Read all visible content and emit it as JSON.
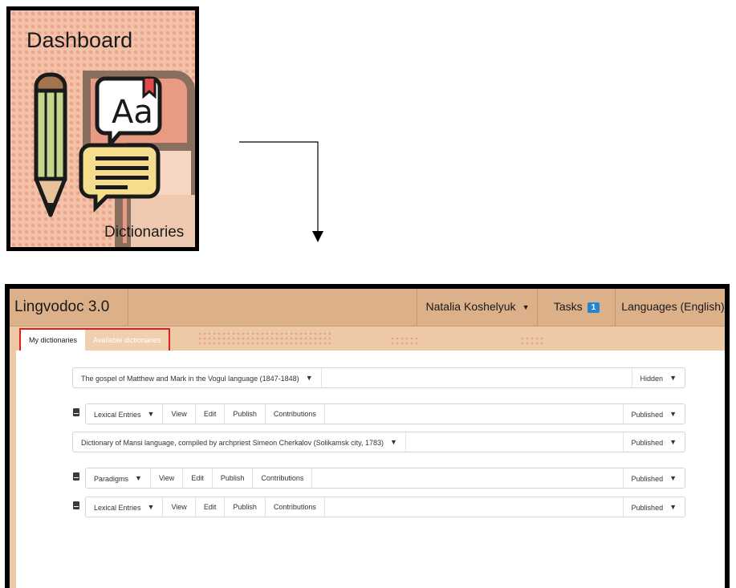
{
  "tile": {
    "title": "Dashboard",
    "subtitle": "Dictionaries"
  },
  "app": {
    "logo": "Lingvodoc 3.0",
    "user": "Natalia Koshelyuk",
    "tasks_label": "Tasks",
    "tasks_count": "1",
    "languages": "Languages (English)"
  },
  "tabs": [
    {
      "label": "My dictionaries",
      "active": true
    },
    {
      "label": "Available dictionaries",
      "active": false
    }
  ],
  "dictionaries": [
    {
      "title": "The gospel of Matthew and Mark in the Vogul language (1847-1848)",
      "status": "Hidden",
      "perspectives": [
        {
          "name": "Lexical Entries",
          "actions": [
            "View",
            "Edit",
            "Publish",
            "Contributions"
          ],
          "status": "Published"
        }
      ]
    },
    {
      "title": "Dictionary of Mansi language, compiled by archpriest Simeon Cherkalov (Solikamsk city, 1783)",
      "status": "Published",
      "perspectives": [
        {
          "name": "Paradigms",
          "actions": [
            "View",
            "Edit",
            "Publish",
            "Contributions"
          ],
          "status": "Published"
        },
        {
          "name": "Lexical Entries",
          "actions": [
            "View",
            "Edit",
            "Publish",
            "Contributions"
          ],
          "status": "Published"
        }
      ]
    }
  ],
  "colors": {
    "topbar": "#dcb088",
    "tabsbar": "#eec9a6",
    "highlight": "#e0201e",
    "badge": "#2185d0"
  }
}
